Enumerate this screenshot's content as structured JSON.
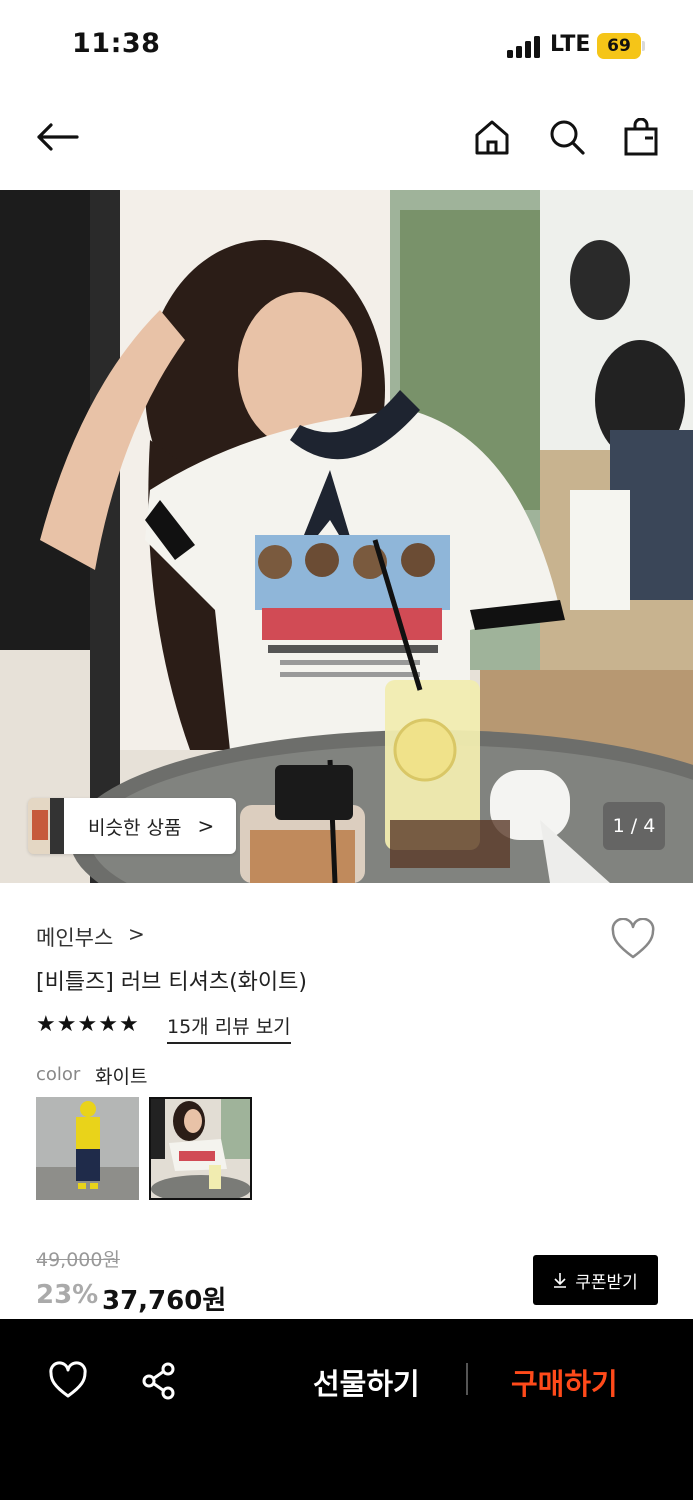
{
  "status_bar": {
    "time": "11:38",
    "network": "LTE",
    "battery": "69",
    "battery_color": "#f5c518"
  },
  "nav": {
    "back_icon": "arrow-left-icon",
    "home_icon": "home-icon",
    "search_icon": "search-icon",
    "cart_icon": "shopping-bag-icon"
  },
  "gallery": {
    "similar_label": "비슷한 상품",
    "similar_chevron": ">",
    "pager": "1 / 4"
  },
  "product": {
    "brand": "메인부스",
    "brand_chevron": ">",
    "title": "[비틀즈] 러브 티셔츠(화이트)",
    "rating_stars": 5,
    "star_glyph": "★",
    "review_link": "15개 리뷰 보기",
    "option_key": "color",
    "option_value": "화이트",
    "original_price": "49,000원",
    "discount": "23%",
    "price": "37,760원",
    "coupon_icon": "download-icon",
    "coupon_label": "쿠폰받기"
  },
  "bottom_bar": {
    "wish_icon": "heart-icon",
    "share_icon": "share-icon",
    "gift_label": "선물하기",
    "buy_label": "구매하기",
    "buy_color": "#ff4a1a"
  }
}
